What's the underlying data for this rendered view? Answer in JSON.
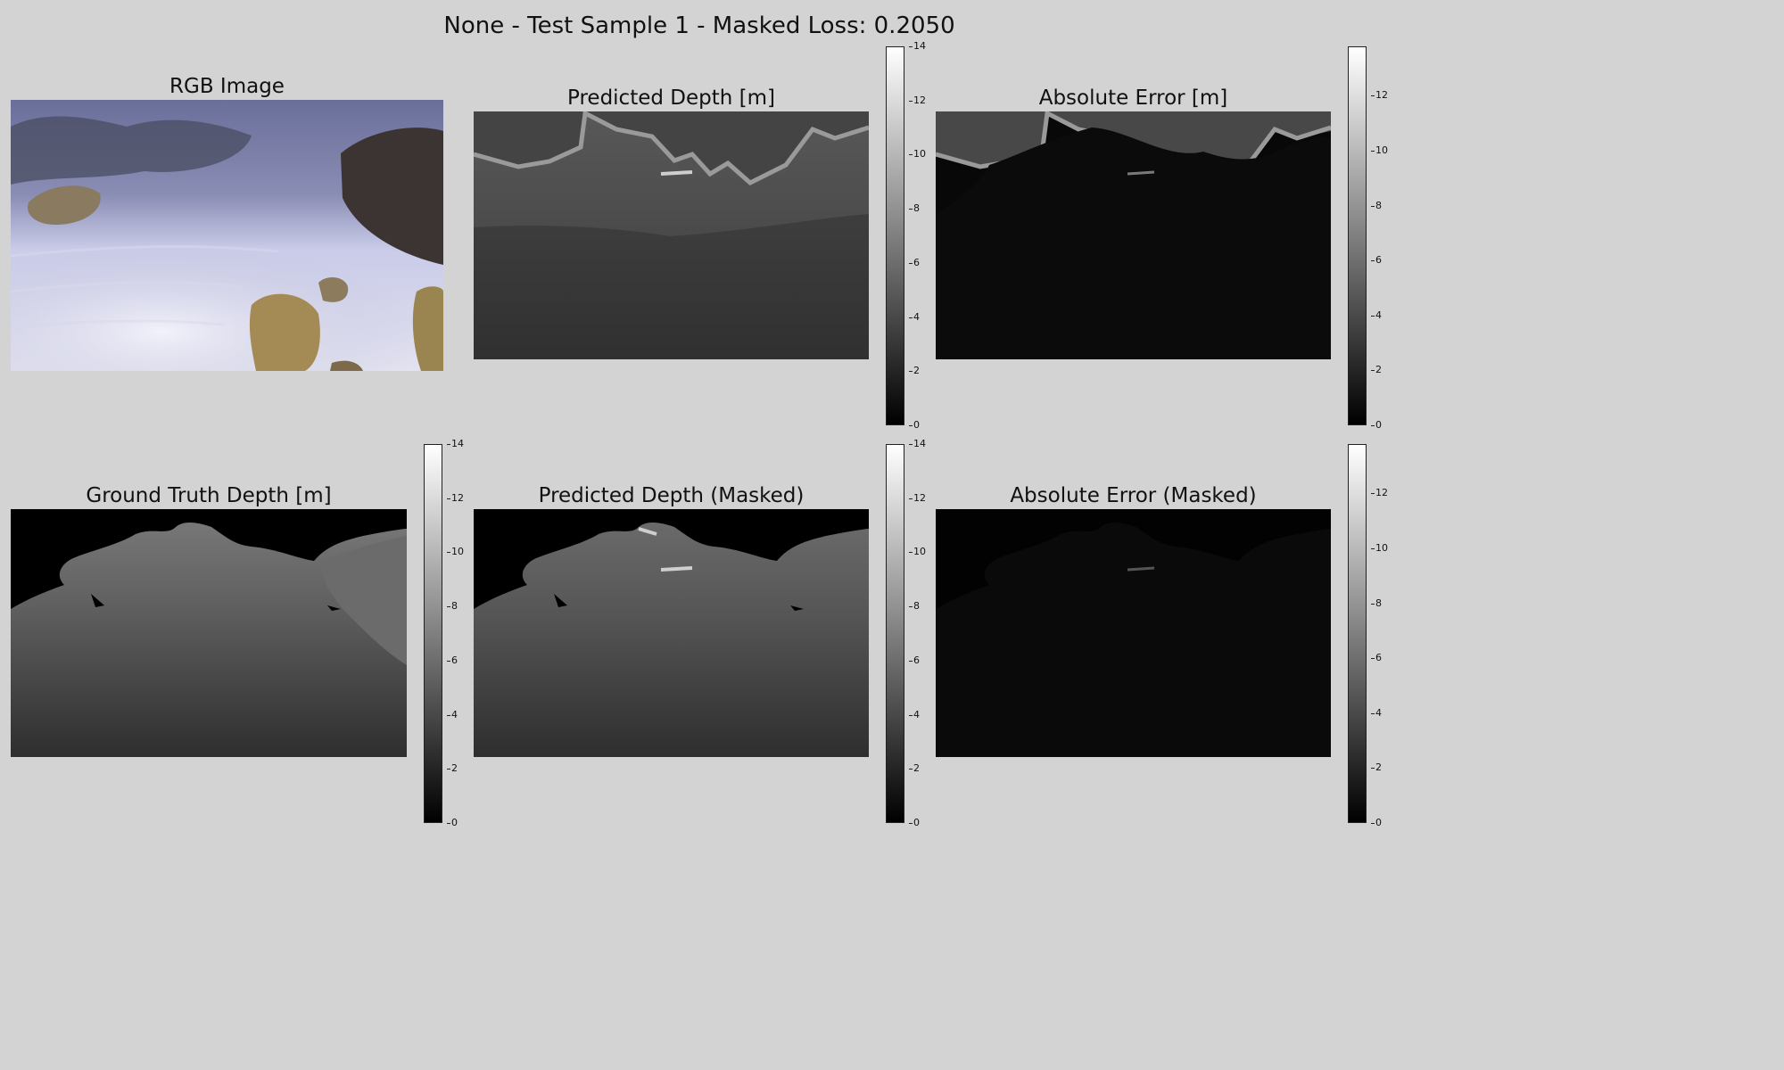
{
  "figure": {
    "suptitle": "None - Test Sample 1 - Masked Loss: 0.2050"
  },
  "panels": [
    {
      "title": "RGB Image",
      "kind": "rgb"
    },
    {
      "title": "Predicted Depth [m]",
      "kind": "pred"
    },
    {
      "title": "Absolute Error [m]",
      "kind": "error"
    },
    {
      "title": "Ground Truth Depth [m]",
      "kind": "gt"
    },
    {
      "title": "Predicted Depth (Masked)",
      "kind": "pred_masked"
    },
    {
      "title": "Absolute Error (Masked)",
      "kind": "error_masked"
    }
  ],
  "colorbars": [
    {
      "panel": "Predicted Depth [m]",
      "ticks": [
        "0",
        "2",
        "4",
        "6",
        "8",
        "10",
        "12",
        "14"
      ],
      "range": [
        0,
        14
      ],
      "colormap": "gray"
    },
    {
      "panel": "Absolute Error [m]",
      "ticks": [
        "0",
        "2",
        "4",
        "6",
        "8",
        "10",
        "12"
      ],
      "range": [
        0,
        13.8
      ],
      "colormap": "gray"
    },
    {
      "panel": "Ground Truth Depth [m]",
      "ticks": [
        "0",
        "2",
        "4",
        "6",
        "8",
        "10",
        "12",
        "14"
      ],
      "range": [
        0,
        14
      ],
      "colormap": "gray"
    },
    {
      "panel": "Predicted Depth (Masked)",
      "ticks": [
        "0",
        "2",
        "4",
        "6",
        "8",
        "10",
        "12",
        "14"
      ],
      "range": [
        0,
        14
      ],
      "colormap": "gray"
    },
    {
      "panel": "Absolute Error (Masked)",
      "ticks": [
        "0",
        "2",
        "4",
        "6",
        "8",
        "10",
        "12"
      ],
      "range": [
        0,
        13.8
      ],
      "colormap": "gray"
    }
  ],
  "chart_data": {
    "type": "heatmap",
    "title": "None - Test Sample 1 - Masked Loss: 0.2050",
    "masked_loss": 0.205,
    "colormap": "gray",
    "depth_range_m": [
      0,
      14
    ],
    "error_range_m": [
      0,
      13.8
    ]
  },
  "colors": {
    "background": "#d3d3d3",
    "cbar_low": "#000000",
    "cbar_high": "#ffffff"
  }
}
